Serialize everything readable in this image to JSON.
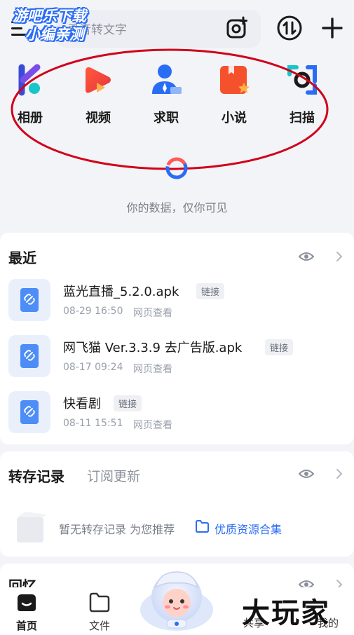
{
  "watermark_top": {
    "line1": "游吧乐下载",
    "line2": "小编亲测"
  },
  "search": {
    "placeholder": "录音转文字"
  },
  "shortcuts": [
    {
      "label": "相册",
      "icon": "album-icon"
    },
    {
      "label": "视频",
      "icon": "video-icon"
    },
    {
      "label": "求职",
      "icon": "job-icon"
    },
    {
      "label": "小说",
      "icon": "novel-icon"
    },
    {
      "label": "扫描",
      "icon": "scan-icon"
    }
  ],
  "privacy_text": "你的数据，仅你可见",
  "recent": {
    "title": "最近",
    "files": [
      {
        "name": "蓝光直播_5.2.0.apk",
        "badge": "链接",
        "time": "08-29 16:50",
        "action": "网页查看"
      },
      {
        "name": "网飞猫 Ver.3.3.9 去广告版.apk",
        "badge": "链接",
        "time": "08-17 09:24",
        "action": "网页查看"
      },
      {
        "name": "快看剧",
        "badge": "链接",
        "time": "08-11 15:51",
        "action": "网页查看"
      }
    ]
  },
  "transfer": {
    "tab_active": "转存记录",
    "tab_inactive": "订阅更新",
    "empty_text": "暂无转存记录 为您推荐",
    "link_text": "优质资源合集"
  },
  "memory": {
    "title": "回忆"
  },
  "bottom_nav": [
    {
      "label": "首页",
      "icon": "home-icon",
      "active": true
    },
    {
      "label": "文件",
      "icon": "folder-icon",
      "active": false
    },
    {
      "label": "共享",
      "icon": "share-icon",
      "active": false
    },
    {
      "label": "我的",
      "icon": "profile-icon",
      "active": false
    }
  ],
  "watermark_bottom": "大玩家",
  "colors": {
    "accent": "#2a6df5",
    "annotation": "#d0021b",
    "background": "#f3f4f7"
  }
}
